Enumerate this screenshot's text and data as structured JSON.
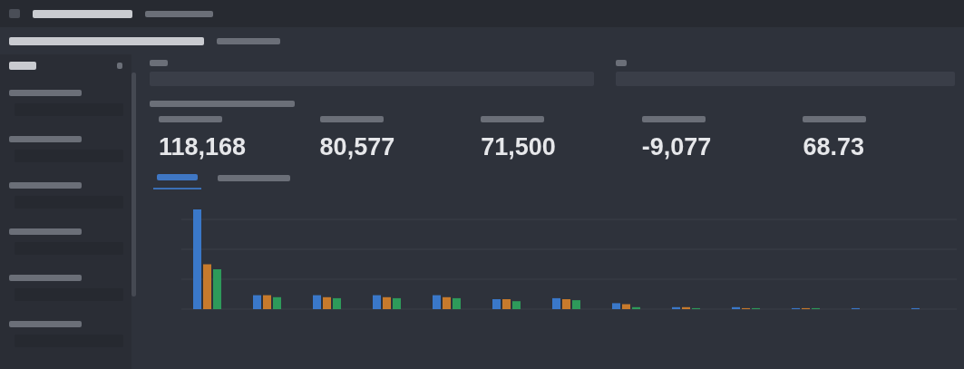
{
  "filters": [
    {
      "kind": "dropdown"
    },
    {
      "kind": "dropdown"
    },
    {
      "kind": "dropdown"
    },
    {
      "kind": "dropdown"
    },
    {
      "kind": "dropdown"
    },
    {
      "kind": "dropdown"
    }
  ],
  "kpis": [
    {
      "value": "118,168"
    },
    {
      "value": "80,577"
    },
    {
      "value": "71,500"
    },
    {
      "value": "-9,077"
    },
    {
      "value": "68.73"
    }
  ],
  "tabs": [
    {
      "selected": true
    },
    {
      "selected": false
    }
  ]
}
